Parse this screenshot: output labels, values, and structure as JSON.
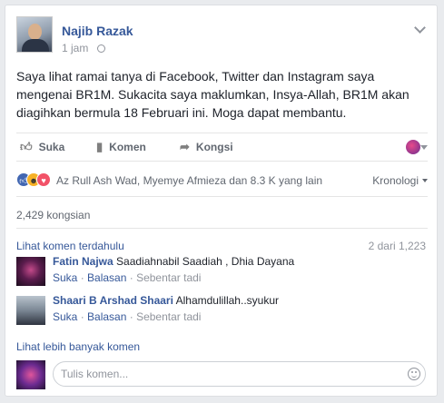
{
  "post": {
    "author": "Najib Razak",
    "time": "1 jam",
    "privacy_icon": "globe-icon",
    "text": "Saya lihat ramai tanya di Facebook, Twitter dan Instagram saya mengenai BR1M. Sukacita saya maklumkan, Insya-Allah, BR1M akan diagihkan bermula 18 Februari ini. Moga dapat membantu."
  },
  "actions": {
    "like": "Suka",
    "comment": "Komen",
    "share": "Kongsi"
  },
  "reactions": {
    "icons": [
      "like-icon",
      "haha-icon",
      "love-icon"
    ],
    "summary": "Az Rull Ash Wad, Myemye Afmieza dan 8.3 K yang lain",
    "order": "Kronologi"
  },
  "shares": "2,429 kongsian",
  "comments": {
    "view_previous": "Lihat komen terdahulu",
    "count": "2 dari 1,223",
    "items": [
      {
        "author": "Fatin Najwa",
        "text": "Saadiahnabil Saadiah , Dhia Dayana",
        "like": "Suka",
        "reply": "Balasan",
        "time": "Sebentar tadi"
      },
      {
        "author": "Shaari B Arshad Shaari",
        "text": "Alhamdulillah..syukur",
        "like": "Suka",
        "reply": "Balasan",
        "time": "Sebentar tadi"
      }
    ],
    "view_more": "Lihat lebih banyak komen"
  },
  "composer": {
    "placeholder": "Tulis komen..."
  },
  "colors": {
    "link": "#365899",
    "like": "#4267b2",
    "haha": "#f7b125",
    "love": "#f25268"
  }
}
